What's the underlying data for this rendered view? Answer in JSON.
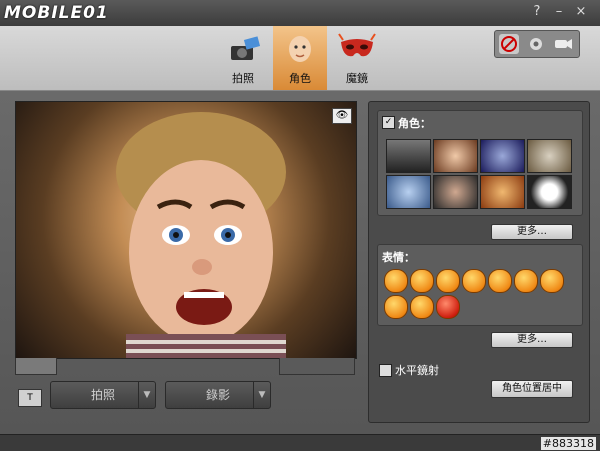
{
  "window": {
    "logo": "MOBILE01",
    "controls": [
      "?",
      "–",
      "×"
    ]
  },
  "toolbar": {
    "tabs": [
      {
        "label": "拍照",
        "icon": "camera-icon"
      },
      {
        "label": "角色",
        "icon": "baby-face-icon",
        "active": true
      },
      {
        "label": "魔鏡",
        "icon": "mask-icon"
      }
    ],
    "right_buttons": [
      "no-record-icon",
      "gear-icon",
      "webcam-icon"
    ]
  },
  "preview": {
    "eye_icon": "eye-icon"
  },
  "controls": {
    "snap_label": "拍照",
    "record_label": "錄影"
  },
  "panel": {
    "characters": {
      "title": "角色：",
      "checked": true,
      "more_label": "更多…"
    },
    "expressions": {
      "title": "表情：",
      "more_label": "更多…"
    },
    "mirror_label": "水平鏡射",
    "center_label": "角色位置居中"
  },
  "footer": {
    "watermark": "#883318"
  },
  "colors": {
    "accent": "#e69a40",
    "panel_bg": "#4b4b4b"
  }
}
